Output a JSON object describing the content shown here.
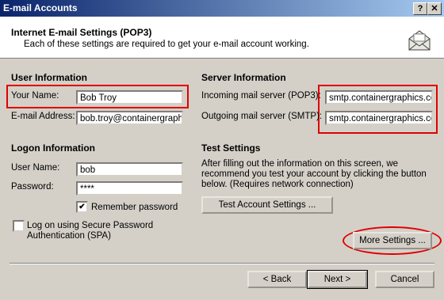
{
  "window": {
    "title": "E-mail Accounts",
    "help_btn": "?",
    "close_btn": "✕"
  },
  "header": {
    "title": "Internet E-mail Settings (POP3)",
    "subtitle": "Each of these settings are required to get your e-mail account working."
  },
  "user_info": {
    "heading": "User Information",
    "name_label": "Your Name:",
    "name_value": "Bob Troy",
    "email_label": "E-mail Address:",
    "email_value": "bob.troy@containergraphics.com"
  },
  "server_info": {
    "heading": "Server Information",
    "incoming_label": "Incoming mail server (POP3):",
    "incoming_value": "smtp.containergraphics.com",
    "outgoing_label": "Outgoing mail server (SMTP):",
    "outgoing_value": "smtp.containergraphics.com"
  },
  "logon_info": {
    "heading": "Logon Information",
    "username_label": "User Name:",
    "username_value": "bob",
    "password_label": "Password:",
    "password_value": "****",
    "remember_label": "Remember password",
    "remember_checked": true,
    "spa_label_line1": "Log on using Secure Password",
    "spa_label_line2": "Authentication (SPA)",
    "spa_checked": false
  },
  "test_settings": {
    "heading": "Test Settings",
    "desc_line1": "After filling out the information on this screen, we",
    "desc_line2": "recommend you test your account by clicking the button",
    "desc_line3": "below. (Requires network connection)",
    "test_button": "Test Account Settings ..."
  },
  "more_settings_button": "More Settings ...",
  "footer": {
    "back": "< Back",
    "next": "Next >",
    "cancel": "Cancel"
  },
  "check_mark": "✔"
}
